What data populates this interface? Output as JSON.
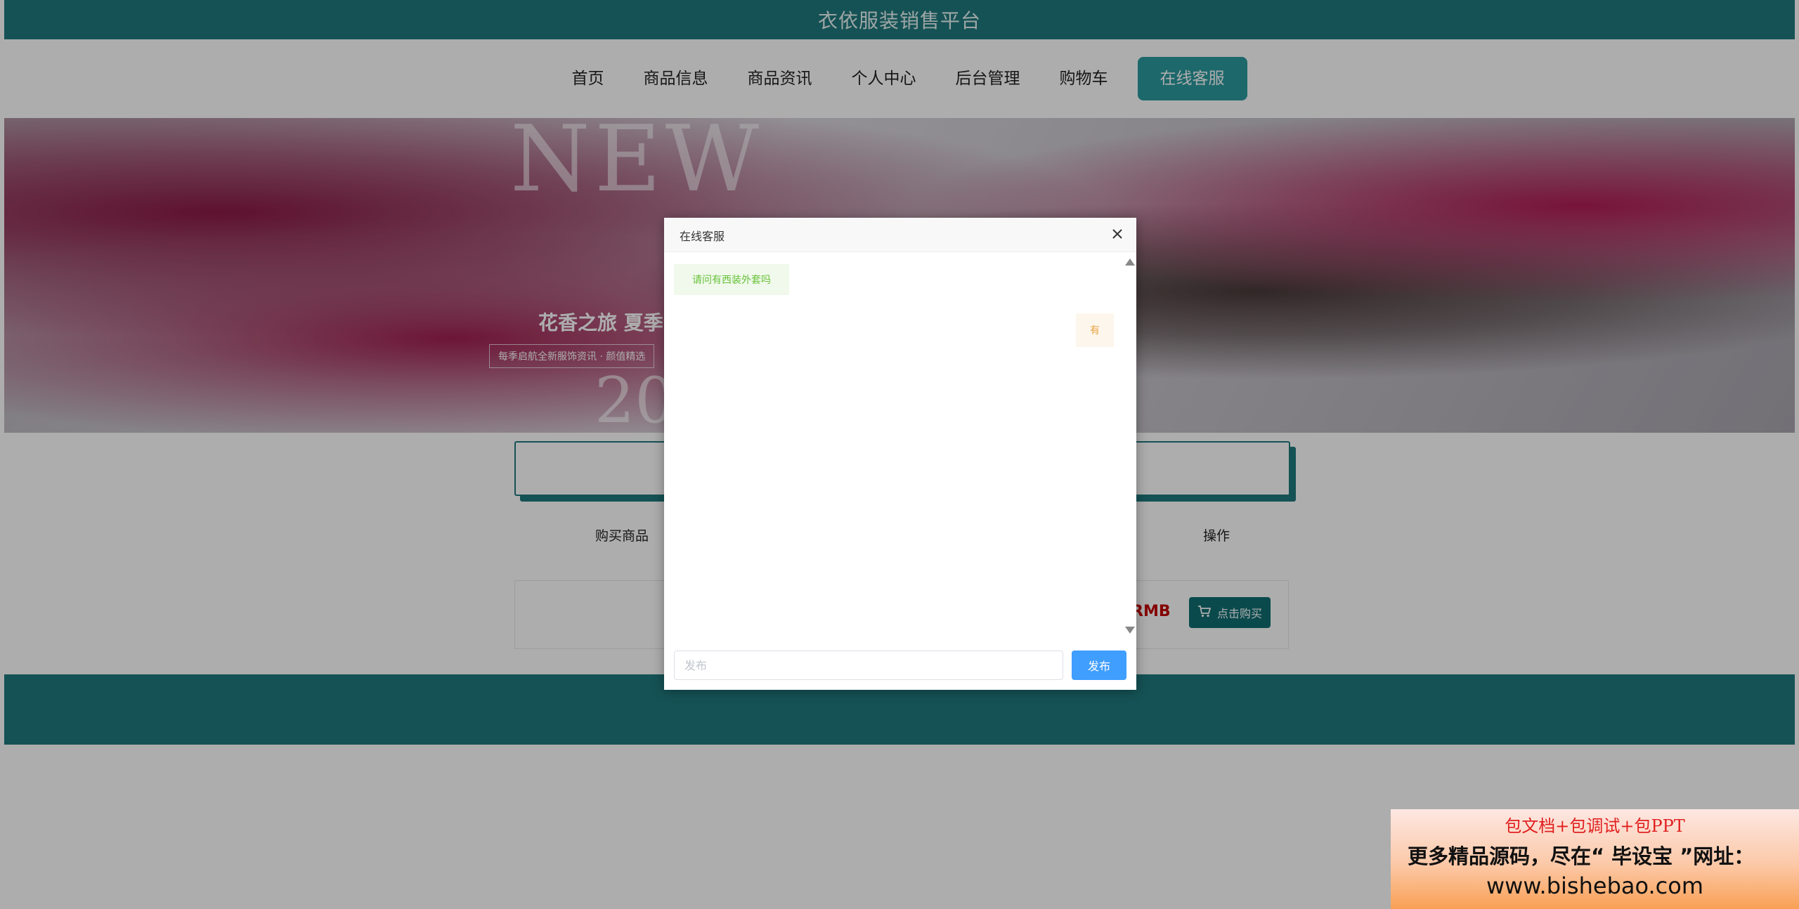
{
  "site": {
    "title": "衣依服装销售平台"
  },
  "nav": {
    "items": [
      "首页",
      "商品信息",
      "商品资讯",
      "个人中心",
      "后台管理",
      "购物车"
    ],
    "active": "在线客服"
  },
  "banner": {
    "headline": "NEW",
    "caption": "花香之旅 夏季",
    "subcaption": "每季启航全新服饰资讯 · 颜值精选",
    "year": "20"
  },
  "table": {
    "headers": {
      "product": "购买商品",
      "action": "操作"
    },
    "row": {
      "price_suffix": "RMB",
      "buy_label": "点击购买"
    }
  },
  "dialog": {
    "title": "在线客服",
    "messages": [
      {
        "side": "left",
        "text": "请问有西装外套吗"
      },
      {
        "side": "right",
        "text": "有"
      }
    ],
    "input_placeholder": "发布",
    "send_label": "发布"
  },
  "ad": {
    "line1": "包文档+包调试+包PPT",
    "line2": "更多精品源码，尽在“ 毕设宝 ”网址：",
    "line3": "www.bishebao.com"
  },
  "colors": {
    "primary": "#207a7e",
    "accent": "#2b9a9e",
    "send_button": "#409eff",
    "price": "#c40000"
  }
}
